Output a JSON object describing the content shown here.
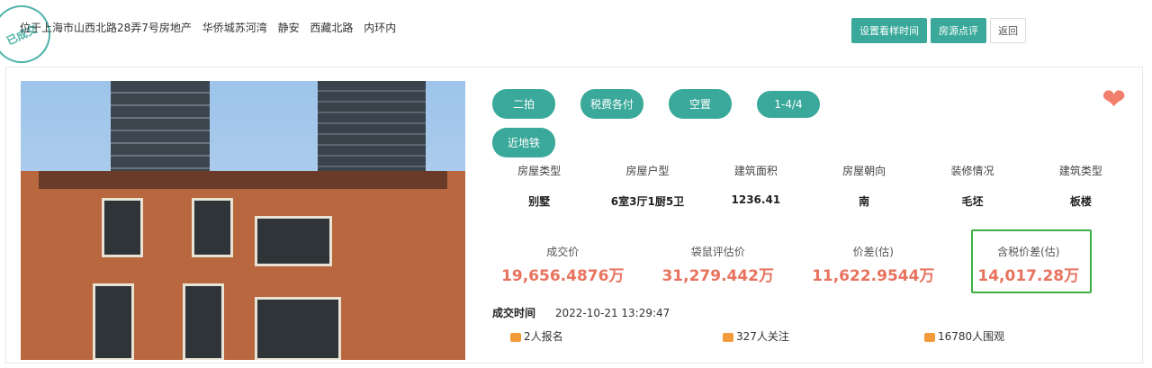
{
  "stamp": "已成交",
  "address": [
    "位于上海市山西北路28弄7号房地产",
    "华侨城苏河湾",
    "静安",
    "西藏北路",
    "内环内"
  ],
  "top_buttons": {
    "schedule": "设置看样时间",
    "review": "房源点评",
    "back": "返回"
  },
  "tags": [
    "二拍",
    "税费各付",
    "空置",
    "1-4/4",
    "近地铁"
  ],
  "attributes": [
    {
      "label": "房屋类型",
      "value": "别墅"
    },
    {
      "label": "房屋户型",
      "value": "6室3厅1厨5卫"
    },
    {
      "label": "建筑面积",
      "value": "1236.41"
    },
    {
      "label": "房屋朝向",
      "value": "南"
    },
    {
      "label": "装修情况",
      "value": "毛坯"
    },
    {
      "label": "建筑类型",
      "value": "板楼"
    }
  ],
  "prices": [
    {
      "label": "成交价",
      "value": "19,656.4876万"
    },
    {
      "label": "袋鼠评估价",
      "value": "31,279.442万"
    },
    {
      "label": "价差(估)",
      "value": "11,622.9544万"
    },
    {
      "label": "含税价差(估)",
      "value": "14,017.28万"
    }
  ],
  "deal": {
    "label": "成交时间",
    "time": "2022-10-21 13:29:47"
  },
  "stats": {
    "signups": "2人报名",
    "followers": "327人关注",
    "views": "16780人围观"
  }
}
